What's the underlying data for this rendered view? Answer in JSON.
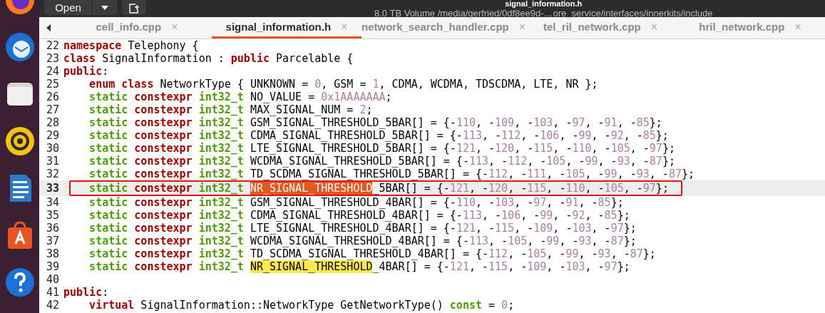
{
  "header": {
    "open_button": "Open",
    "title": "signal_information.h",
    "subtitle": "8.0 TB Volume /media/gerfried/0df8ee9d-…ore_service/interfaces/innerkits/include"
  },
  "tabs": [
    {
      "label": "cell_info.cpp",
      "close": "×",
      "selected": false
    },
    {
      "label": "signal_information.h",
      "close": "×",
      "selected": true
    },
    {
      "label": "network_search_handler.cpp",
      "close": "×",
      "selected": false
    },
    {
      "label": "tel_ril_network.cpp",
      "close": "×",
      "selected": false
    },
    {
      "label": "hril_network.cpp",
      "close": "×",
      "selected": false
    }
  ],
  "lines": [
    {
      "number": "22",
      "indented": false,
      "current": false,
      "boxed": false,
      "tokens": [
        {
          "kind": "keyword",
          "text": "namespace"
        },
        {
          "kind": "plain",
          "text": " Telephony {"
        }
      ]
    },
    {
      "number": "23",
      "indented": false,
      "current": false,
      "boxed": false,
      "tokens": [
        {
          "kind": "keyword",
          "text": "class"
        },
        {
          "kind": "plain",
          "text": " SignalInformation : "
        },
        {
          "kind": "keyword",
          "text": "public"
        },
        {
          "kind": "plain",
          "text": " Parcelable {"
        }
      ]
    },
    {
      "number": "24",
      "indented": false,
      "current": false,
      "boxed": false,
      "tokens": [
        {
          "kind": "keyword",
          "text": "public"
        },
        {
          "kind": "plain",
          "text": ":"
        }
      ]
    },
    {
      "number": "25",
      "indented": true,
      "current": false,
      "boxed": false,
      "tokens": [
        {
          "kind": "keyword",
          "text": "enum class"
        },
        {
          "kind": "plain",
          "text": " NetworkType { UNKNOWN = "
        },
        {
          "kind": "number",
          "text": "0"
        },
        {
          "kind": "plain",
          "text": ", GSM = "
        },
        {
          "kind": "number",
          "text": "1"
        },
        {
          "kind": "plain",
          "text": ", CDMA, WCDMA, TDSCDMA, LTE, NR };"
        }
      ]
    },
    {
      "number": "26",
      "indented": true,
      "current": false,
      "boxed": false,
      "tokens": [
        {
          "kind": "type",
          "text": "static"
        },
        {
          "kind": "keyword",
          "text": " constexpr"
        },
        {
          "kind": "type",
          "text": " int32_t"
        },
        {
          "kind": "plain",
          "text": " NO_VALUE = "
        },
        {
          "kind": "number",
          "text": "0x1AAAAAAA"
        },
        {
          "kind": "plain",
          "text": ";"
        }
      ]
    },
    {
      "number": "27",
      "indented": true,
      "current": false,
      "boxed": false,
      "tokens": [
        {
          "kind": "type",
          "text": "static"
        },
        {
          "kind": "keyword",
          "text": " constexpr"
        },
        {
          "kind": "type",
          "text": " int32_t"
        },
        {
          "kind": "plain",
          "text": " MAX_SIGNAL_NUM = "
        },
        {
          "kind": "number",
          "text": "2"
        },
        {
          "kind": "plain",
          "text": ";"
        }
      ]
    },
    {
      "number": "28",
      "indented": true,
      "current": false,
      "boxed": false,
      "tokens": [
        {
          "kind": "type",
          "text": "static"
        },
        {
          "kind": "keyword",
          "text": " constexpr"
        },
        {
          "kind": "type",
          "text": " int32_t"
        },
        {
          "kind": "plain",
          "text": " GSM_SIGNAL_THRESHOLD_5BAR[] = {-"
        },
        {
          "kind": "number",
          "text": "110"
        },
        {
          "kind": "plain",
          "text": ", -"
        },
        {
          "kind": "number",
          "text": "109"
        },
        {
          "kind": "plain",
          "text": ", -"
        },
        {
          "kind": "number",
          "text": "103"
        },
        {
          "kind": "plain",
          "text": ", -"
        },
        {
          "kind": "number",
          "text": "97"
        },
        {
          "kind": "plain",
          "text": ", -"
        },
        {
          "kind": "number",
          "text": "91"
        },
        {
          "kind": "plain",
          "text": ", -"
        },
        {
          "kind": "number",
          "text": "85"
        },
        {
          "kind": "plain",
          "text": "};"
        }
      ]
    },
    {
      "number": "29",
      "indented": true,
      "current": false,
      "boxed": false,
      "tokens": [
        {
          "kind": "type",
          "text": "static"
        },
        {
          "kind": "keyword",
          "text": " constexpr"
        },
        {
          "kind": "type",
          "text": " int32_t"
        },
        {
          "kind": "plain",
          "text": " CDMA_SIGNAL_THRESHOLD_5BAR[] = {-"
        },
        {
          "kind": "number",
          "text": "113"
        },
        {
          "kind": "plain",
          "text": ", -"
        },
        {
          "kind": "number",
          "text": "112"
        },
        {
          "kind": "plain",
          "text": ", -"
        },
        {
          "kind": "number",
          "text": "106"
        },
        {
          "kind": "plain",
          "text": ", -"
        },
        {
          "kind": "number",
          "text": "99"
        },
        {
          "kind": "plain",
          "text": ", -"
        },
        {
          "kind": "number",
          "text": "92"
        },
        {
          "kind": "plain",
          "text": ", -"
        },
        {
          "kind": "number",
          "text": "85"
        },
        {
          "kind": "plain",
          "text": "};"
        }
      ]
    },
    {
      "number": "30",
      "indented": true,
      "current": false,
      "boxed": false,
      "tokens": [
        {
          "kind": "type",
          "text": "static"
        },
        {
          "kind": "keyword",
          "text": " constexpr"
        },
        {
          "kind": "type",
          "text": " int32_t"
        },
        {
          "kind": "plain",
          "text": " LTE_SIGNAL_THRESHOLD_5BAR[] = {-"
        },
        {
          "kind": "number",
          "text": "121"
        },
        {
          "kind": "plain",
          "text": ", -"
        },
        {
          "kind": "number",
          "text": "120"
        },
        {
          "kind": "plain",
          "text": ", -"
        },
        {
          "kind": "number",
          "text": "115"
        },
        {
          "kind": "plain",
          "text": ", -"
        },
        {
          "kind": "number",
          "text": "110"
        },
        {
          "kind": "plain",
          "text": ", -"
        },
        {
          "kind": "number",
          "text": "105"
        },
        {
          "kind": "plain",
          "text": ", -"
        },
        {
          "kind": "number",
          "text": "97"
        },
        {
          "kind": "plain",
          "text": "};"
        }
      ]
    },
    {
      "number": "31",
      "indented": true,
      "current": false,
      "boxed": false,
      "tokens": [
        {
          "kind": "type",
          "text": "static"
        },
        {
          "kind": "keyword",
          "text": " constexpr"
        },
        {
          "kind": "type",
          "text": " int32_t"
        },
        {
          "kind": "plain",
          "text": " WCDMA_SIGNAL_THRESHOLD_5BAR[] = {-"
        },
        {
          "kind": "number",
          "text": "113"
        },
        {
          "kind": "plain",
          "text": ", -"
        },
        {
          "kind": "number",
          "text": "112"
        },
        {
          "kind": "plain",
          "text": ", -"
        },
        {
          "kind": "number",
          "text": "105"
        },
        {
          "kind": "plain",
          "text": ", -"
        },
        {
          "kind": "number",
          "text": "99"
        },
        {
          "kind": "plain",
          "text": ", -"
        },
        {
          "kind": "number",
          "text": "93"
        },
        {
          "kind": "plain",
          "text": ", -"
        },
        {
          "kind": "number",
          "text": "87"
        },
        {
          "kind": "plain",
          "text": "};"
        }
      ]
    },
    {
      "number": "32",
      "indented": true,
      "current": false,
      "boxed": false,
      "tokens": [
        {
          "kind": "type",
          "text": "static"
        },
        {
          "kind": "keyword",
          "text": " constexpr"
        },
        {
          "kind": "type",
          "text": " int32_t"
        },
        {
          "kind": "plain",
          "text": " TD_SCDMA_SIGNAL_THRESHOLD_5BAR[] = {-"
        },
        {
          "kind": "number",
          "text": "112"
        },
        {
          "kind": "plain",
          "text": ", -"
        },
        {
          "kind": "number",
          "text": "111"
        },
        {
          "kind": "plain",
          "text": ", -"
        },
        {
          "kind": "number",
          "text": "105"
        },
        {
          "kind": "plain",
          "text": ", -"
        },
        {
          "kind": "number",
          "text": "99"
        },
        {
          "kind": "plain",
          "text": ", -"
        },
        {
          "kind": "number",
          "text": "93"
        },
        {
          "kind": "plain",
          "text": ", -"
        },
        {
          "kind": "number",
          "text": "87"
        },
        {
          "kind": "plain",
          "text": "};"
        }
      ]
    },
    {
      "number": "33",
      "indented": true,
      "current": true,
      "boxed": true,
      "tokens": [
        {
          "kind": "type",
          "text": "static"
        },
        {
          "kind": "keyword",
          "text": " constexpr"
        },
        {
          "kind": "type",
          "text": " int32_t "
        },
        {
          "kind": "current",
          "text": "NR_SIGNAL_THRESHOLD"
        },
        {
          "kind": "plain",
          "text": "_5BAR[] = {-"
        },
        {
          "kind": "number",
          "text": "121"
        },
        {
          "kind": "plain",
          "text": ", -"
        },
        {
          "kind": "number",
          "text": "120"
        },
        {
          "kind": "plain",
          "text": ", -"
        },
        {
          "kind": "number",
          "text": "115"
        },
        {
          "kind": "plain",
          "text": ", -"
        },
        {
          "kind": "number",
          "text": "110"
        },
        {
          "kind": "plain",
          "text": ", -"
        },
        {
          "kind": "number",
          "text": "105"
        },
        {
          "kind": "plain",
          "text": ", -"
        },
        {
          "kind": "number",
          "text": "97"
        },
        {
          "kind": "plain",
          "text": "};"
        }
      ]
    },
    {
      "number": "34",
      "indented": true,
      "current": false,
      "boxed": false,
      "tokens": [
        {
          "kind": "type",
          "text": "static"
        },
        {
          "kind": "keyword",
          "text": " constexpr"
        },
        {
          "kind": "type",
          "text": " int32_t"
        },
        {
          "kind": "plain",
          "text": " GSM_SIGNAL_THRESHOLD_4BAR[] = {-"
        },
        {
          "kind": "number",
          "text": "110"
        },
        {
          "kind": "plain",
          "text": ", -"
        },
        {
          "kind": "number",
          "text": "103"
        },
        {
          "kind": "plain",
          "text": ", -"
        },
        {
          "kind": "number",
          "text": "97"
        },
        {
          "kind": "plain",
          "text": ", -"
        },
        {
          "kind": "number",
          "text": "91"
        },
        {
          "kind": "plain",
          "text": ", -"
        },
        {
          "kind": "number",
          "text": "85"
        },
        {
          "kind": "plain",
          "text": "};"
        }
      ]
    },
    {
      "number": "35",
      "indented": true,
      "current": false,
      "boxed": false,
      "tokens": [
        {
          "kind": "type",
          "text": "static"
        },
        {
          "kind": "keyword",
          "text": " constexpr"
        },
        {
          "kind": "type",
          "text": " int32_t"
        },
        {
          "kind": "plain",
          "text": " CDMA_SIGNAL_THRESHOLD_4BAR[] = {-"
        },
        {
          "kind": "number",
          "text": "113"
        },
        {
          "kind": "plain",
          "text": ", -"
        },
        {
          "kind": "number",
          "text": "106"
        },
        {
          "kind": "plain",
          "text": ", -"
        },
        {
          "kind": "number",
          "text": "99"
        },
        {
          "kind": "plain",
          "text": ", -"
        },
        {
          "kind": "number",
          "text": "92"
        },
        {
          "kind": "plain",
          "text": ", -"
        },
        {
          "kind": "number",
          "text": "85"
        },
        {
          "kind": "plain",
          "text": "};"
        }
      ]
    },
    {
      "number": "36",
      "indented": true,
      "current": false,
      "boxed": false,
      "tokens": [
        {
          "kind": "type",
          "text": "static"
        },
        {
          "kind": "keyword",
          "text": " constexpr"
        },
        {
          "kind": "type",
          "text": " int32_t"
        },
        {
          "kind": "plain",
          "text": " LTE_SIGNAL_THRESHOLD_4BAR[] = {-"
        },
        {
          "kind": "number",
          "text": "121"
        },
        {
          "kind": "plain",
          "text": ", -"
        },
        {
          "kind": "number",
          "text": "115"
        },
        {
          "kind": "plain",
          "text": ", -"
        },
        {
          "kind": "number",
          "text": "109"
        },
        {
          "kind": "plain",
          "text": ", -"
        },
        {
          "kind": "number",
          "text": "103"
        },
        {
          "kind": "plain",
          "text": ", -"
        },
        {
          "kind": "number",
          "text": "97"
        },
        {
          "kind": "plain",
          "text": "};"
        }
      ]
    },
    {
      "number": "37",
      "indented": true,
      "current": false,
      "boxed": false,
      "tokens": [
        {
          "kind": "type",
          "text": "static"
        },
        {
          "kind": "keyword",
          "text": " constexpr"
        },
        {
          "kind": "type",
          "text": " int32_t"
        },
        {
          "kind": "plain",
          "text": " WCDMA_SIGNAL_THRESHOLD_4BAR[] = {-"
        },
        {
          "kind": "number",
          "text": "113"
        },
        {
          "kind": "plain",
          "text": ", -"
        },
        {
          "kind": "number",
          "text": "105"
        },
        {
          "kind": "plain",
          "text": ", -"
        },
        {
          "kind": "number",
          "text": "99"
        },
        {
          "kind": "plain",
          "text": ", -"
        },
        {
          "kind": "number",
          "text": "93"
        },
        {
          "kind": "plain",
          "text": ", -"
        },
        {
          "kind": "number",
          "text": "87"
        },
        {
          "kind": "plain",
          "text": "};"
        }
      ]
    },
    {
      "number": "38",
      "indented": true,
      "current": false,
      "boxed": false,
      "tokens": [
        {
          "kind": "type",
          "text": "static"
        },
        {
          "kind": "keyword",
          "text": " constexpr"
        },
        {
          "kind": "type",
          "text": " int32_t"
        },
        {
          "kind": "plain",
          "text": " TD_SCDMA_SIGNAL_THRESHOLD_4BAR[] = {-"
        },
        {
          "kind": "number",
          "text": "112"
        },
        {
          "kind": "plain",
          "text": ", -"
        },
        {
          "kind": "number",
          "text": "105"
        },
        {
          "kind": "plain",
          "text": ", -"
        },
        {
          "kind": "number",
          "text": "99"
        },
        {
          "kind": "plain",
          "text": ", -"
        },
        {
          "kind": "number",
          "text": "93"
        },
        {
          "kind": "plain",
          "text": ", -"
        },
        {
          "kind": "number",
          "text": "87"
        },
        {
          "kind": "plain",
          "text": "};"
        }
      ]
    },
    {
      "number": "39",
      "indented": true,
      "current": false,
      "boxed": false,
      "tokens": [
        {
          "kind": "type",
          "text": "static"
        },
        {
          "kind": "keyword",
          "text": " constexpr"
        },
        {
          "kind": "type",
          "text": " int32_t "
        },
        {
          "kind": "match",
          "text": "NR_SIGNAL_THRESHOLD"
        },
        {
          "kind": "plain",
          "text": "_4BAR[] = {-"
        },
        {
          "kind": "number",
          "text": "121"
        },
        {
          "kind": "plain",
          "text": ", -"
        },
        {
          "kind": "number",
          "text": "115"
        },
        {
          "kind": "plain",
          "text": ", -"
        },
        {
          "kind": "number",
          "text": "109"
        },
        {
          "kind": "plain",
          "text": ", -"
        },
        {
          "kind": "number",
          "text": "103"
        },
        {
          "kind": "plain",
          "text": ", -"
        },
        {
          "kind": "number",
          "text": "97"
        },
        {
          "kind": "plain",
          "text": "};"
        }
      ]
    },
    {
      "number": "40",
      "current": false,
      "boxed": false
    },
    {
      "number": "41",
      "indented": false,
      "current": false,
      "boxed": false,
      "tokens": [
        {
          "kind": "keyword",
          "text": "public"
        },
        {
          "kind": "plain",
          "text": ":"
        }
      ]
    },
    {
      "number": "42",
      "indented": true,
      "current": false,
      "boxed": false,
      "tokens": [
        {
          "kind": "keyword",
          "text": "virtual"
        },
        {
          "kind": "plain",
          "text": " SignalInformation::NetworkType GetNetworkType() "
        },
        {
          "kind": "type",
          "text": "const"
        },
        {
          "kind": "plain",
          "text": " = "
        },
        {
          "kind": "number",
          "text": "0"
        },
        {
          "kind": "plain",
          "text": ";"
        }
      ]
    }
  ]
}
